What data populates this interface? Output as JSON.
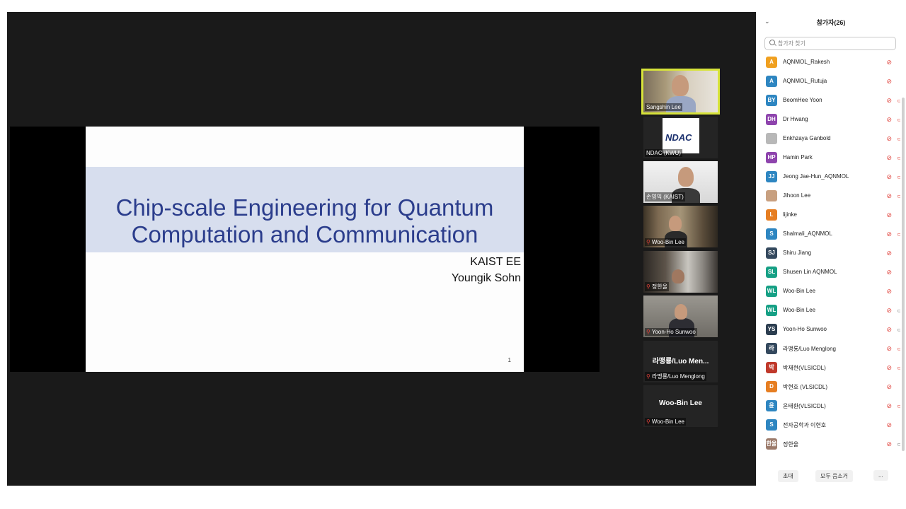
{
  "slide": {
    "title": "Chip-scale Engineering for Quantum\nComputation and Communication",
    "org": "KAIST EE",
    "author": "Youngik Sohn",
    "page_number": "1"
  },
  "video_tiles": [
    {
      "name": "Sangshin Lee",
      "muted": false,
      "active": true
    },
    {
      "name": "NDAC (KWU)",
      "muted": false,
      "logo_text": "NDAC"
    },
    {
      "name": "손영익 (KAIST)",
      "muted": false
    },
    {
      "name": "Woo-Bin Lee",
      "muted": true
    },
    {
      "name": "정한울",
      "muted": true
    },
    {
      "name": "Yoon-Ho Sunwoo",
      "muted": true
    },
    {
      "name": "라맹룡/Luo Menglong",
      "muted": true,
      "display": "라맹룡/Luo  Men..."
    },
    {
      "name": "Woo-Bin Lee",
      "muted": true,
      "display": "Woo-Bin Lee"
    }
  ],
  "panel": {
    "title": "참가자(26)",
    "search_placeholder": "참가자 찾기",
    "collapse_icon": "chevron-down",
    "participants": [
      {
        "initials": "A",
        "name": "AQNMOL_Rakesh",
        "color": "#f0a020",
        "mic": "muted",
        "cam": ""
      },
      {
        "initials": "A",
        "name": "AQNMOL_Rutuja",
        "color": "#2e86c1",
        "mic": "muted",
        "cam": ""
      },
      {
        "initials": "BY",
        "name": "BeomHee Yoon",
        "color": "#2e86c1",
        "mic": "muted",
        "cam": "off"
      },
      {
        "initials": "DH",
        "name": "Dr Hwang",
        "color": "#8e44ad",
        "mic": "muted",
        "cam": "off"
      },
      {
        "initials": "",
        "name": "Enkhzaya Ganbold",
        "color": "#b8b8b8",
        "mic": "muted",
        "cam": "off"
      },
      {
        "initials": "HP",
        "name": "Hamin Park",
        "color": "#8e44ad",
        "mic": "muted",
        "cam": "off"
      },
      {
        "initials": "JJ",
        "name": "Jeong Jae-Hun_AQNMOL",
        "color": "#2e86c1",
        "mic": "muted",
        "cam": "off"
      },
      {
        "initials": "",
        "name": "Jihoon Lee",
        "color": "#c8a080",
        "mic": "muted",
        "cam": "off"
      },
      {
        "initials": "L",
        "name": "lijinke",
        "color": "#e67e22",
        "mic": "muted",
        "cam": ""
      },
      {
        "initials": "S",
        "name": "Shalmali_AQNMOL",
        "color": "#2e86c1",
        "mic": "muted",
        "cam": "off"
      },
      {
        "initials": "SJ",
        "name": "Shiru Jiang",
        "color": "#34495e",
        "mic": "muted",
        "cam": ""
      },
      {
        "initials": "SL",
        "name": "Shusen Lin AQNMOL",
        "color": "#16a085",
        "mic": "muted",
        "cam": ""
      },
      {
        "initials": "WL",
        "name": "Woo-Bin Lee",
        "color": "#16a085",
        "mic": "muted",
        "cam": ""
      },
      {
        "initials": "WL",
        "name": "Woo-Bin Lee",
        "color": "#16a085",
        "mic": "muted",
        "cam": "on"
      },
      {
        "initials": "YS",
        "name": "Yoon-Ho Sunwoo",
        "color": "#2c3e50",
        "mic": "muted",
        "cam": "on"
      },
      {
        "initials": "라",
        "name": "라맹룡/Luo Menglong",
        "color": "#34495e",
        "mic": "muted",
        "cam": "off"
      },
      {
        "initials": "박",
        "name": "박재현(VLSICDL)",
        "color": "#c0392b",
        "mic": "muted",
        "cam": "off"
      },
      {
        "initials": "D",
        "name": "박현호 (VLSICDL)",
        "color": "#e67e22",
        "mic": "muted",
        "cam": ""
      },
      {
        "initials": "윤",
        "name": "윤태환(VLSICDL)",
        "color": "#2e86c1",
        "mic": "muted",
        "cam": "off"
      },
      {
        "initials": "S",
        "name": "전자공학과 이현호",
        "color": "#2e86c1",
        "mic": "muted",
        "cam": ""
      },
      {
        "initials": "한울",
        "name": "정한울",
        "color": "#9c7b6b",
        "mic": "muted",
        "cam": "on"
      }
    ],
    "footer": {
      "invite": "초대",
      "mute_all": "모두 음소거",
      "more": "..."
    }
  }
}
